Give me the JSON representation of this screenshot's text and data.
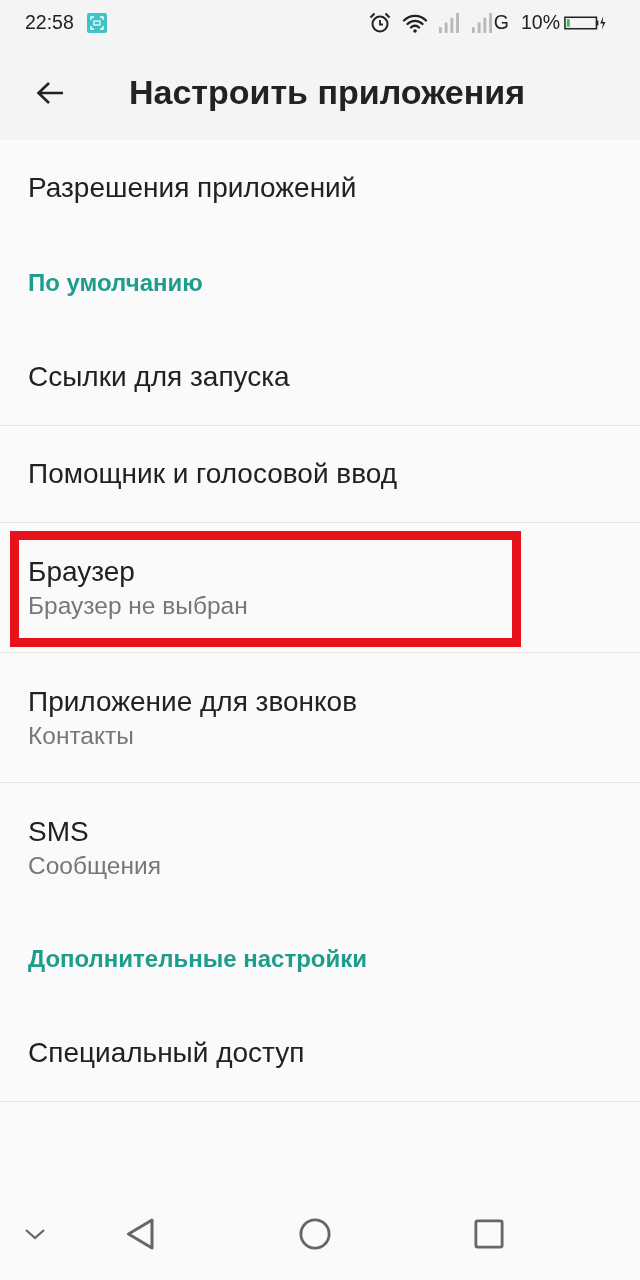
{
  "status_bar": {
    "time": "22:58",
    "network": "G",
    "battery": "10%"
  },
  "toolbar": {
    "title": "Настроить приложения"
  },
  "items": [
    {
      "kind": "item",
      "title": "Разрешения приложений",
      "highlighted": false
    },
    {
      "kind": "header",
      "title": "По умолчанию",
      "highlighted": false
    },
    {
      "kind": "item",
      "title": "Ссылки для запуска",
      "highlighted": false
    },
    {
      "kind": "item",
      "title": "Помощник и голосовой ввод",
      "highlighted": false
    },
    {
      "kind": "item",
      "title": "Браузер",
      "subtitle": "Браузер не выбран",
      "highlighted": true
    },
    {
      "kind": "item",
      "title": "Приложение для звонков",
      "subtitle": "Контакты",
      "highlighted": false
    },
    {
      "kind": "item",
      "title": "SMS",
      "subtitle": "Сообщения",
      "highlighted": false
    },
    {
      "kind": "header",
      "title": "Дополнительные настройки",
      "highlighted": false
    },
    {
      "kind": "item",
      "title": "Специальный доступ",
      "highlighted": false
    }
  ]
}
